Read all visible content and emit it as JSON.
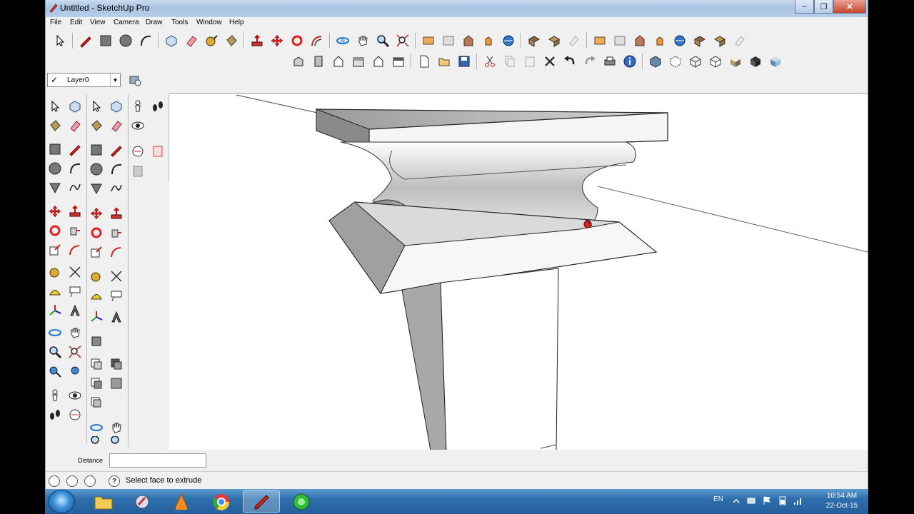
{
  "window": {
    "title": "Untitled - SketchUp Pro",
    "minimize_glyph": "‒",
    "maximize_glyph": "❐",
    "close_glyph": "✕"
  },
  "menu": {
    "items": [
      "File",
      "Edit",
      "View",
      "Camera",
      "Draw",
      "Tools",
      "Window",
      "Help"
    ]
  },
  "layer": {
    "current": "Layer0",
    "check_glyph": "✓",
    "arrow_glyph": "▼"
  },
  "vcb": {
    "label": "Distance",
    "value": ""
  },
  "status": {
    "help_glyph": "?",
    "message": "Select face to extrude"
  },
  "taskbar": {
    "language": "EN",
    "time": "10:54 AM",
    "date": "22-Oct-15",
    "apps": [
      "explorer-icon",
      "sketchup-layout-icon",
      "vlc-icon",
      "chrome-icon",
      "sketchup-icon",
      "camtasia-icon"
    ]
  },
  "colors": {
    "accent": "#24609c",
    "viewport_bg": "#ffffff",
    "chrome_bg": "#f0f0f0"
  }
}
